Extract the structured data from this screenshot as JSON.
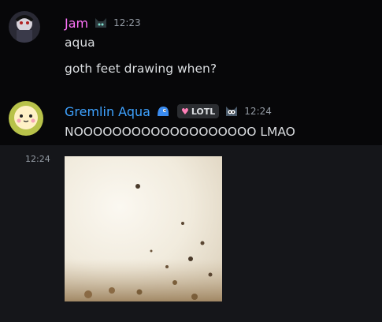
{
  "messages": [
    {
      "author": "Jam",
      "author_color": "#ff73fa",
      "timestamp": "12:23",
      "lines": [
        "aqua",
        "goth feet drawing when?"
      ]
    },
    {
      "author": "Gremlin Aqua",
      "author_color": "#3ea2ff",
      "timestamp": "12:24",
      "badge": "LOTL",
      "badge_icon": "heart-icon",
      "lines": [
        "NOOOOOOOOOOOOOOOOOOO LMAO"
      ]
    }
  ],
  "followup": {
    "timestamp": "12:24",
    "attachment": "image-attachment"
  }
}
